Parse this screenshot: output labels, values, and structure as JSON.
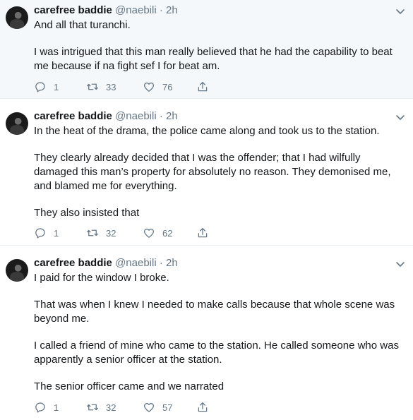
{
  "tweets": [
    {
      "name": "carefree baddie",
      "handle": "@naebili",
      "separator": "·",
      "time": "2h",
      "paragraphs": [
        "And all that turanchi.",
        "I was intrigued that this man really believed that he had the capability to beat me because if na fight sef I for beat am."
      ],
      "replies": "1",
      "retweets": "33",
      "likes": "76"
    },
    {
      "name": "carefree baddie",
      "handle": "@naebili",
      "separator": "·",
      "time": "2h",
      "paragraphs": [
        "In the heat of the drama, the police came along and took us to the station.",
        "They clearly already decided that I was the offender; that I had wilfully damaged this man’s property for absolutely no reason. They demonised me, and blamed me for everything.",
        "They also insisted that"
      ],
      "replies": "1",
      "retweets": "32",
      "likes": "62"
    },
    {
      "name": "carefree baddie",
      "handle": "@naebili",
      "separator": "·",
      "time": "2h",
      "paragraphs": [
        "I paid for the window I broke.",
        "That was when I knew I needed to make calls because that whole scene was beyond me.",
        "I called a friend of mine who came to the station. He called someone who was apparently a senior officer at the station.",
        "The senior officer came and we narrated"
      ],
      "replies": "1",
      "retweets": "32",
      "likes": "57"
    }
  ],
  "icons": {
    "reply": "reply-icon",
    "retweet": "retweet-icon",
    "like": "heart-icon",
    "share": "share-icon",
    "more": "chevron-down-icon"
  },
  "colors": {
    "first_tweet_background": "#f5f8fa",
    "secondary_text": "#657786",
    "divider": "#e6ecf0"
  }
}
